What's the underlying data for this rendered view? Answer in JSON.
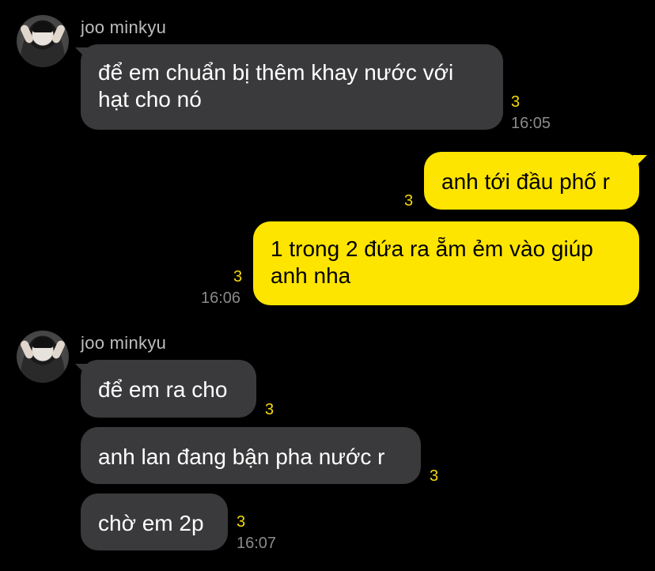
{
  "messages": [
    {
      "sender": "joo minkyu",
      "text_lines": [
        "để em chuẩn bị thêm khay nước với",
        "hạt cho nó"
      ],
      "unread": "3",
      "time": "16:05"
    },
    {
      "text": "anh tới đầu phố r",
      "unread": "3"
    },
    {
      "text_lines": [
        "1 trong 2 đứa ra ẵm ẻm vào giúp",
        "anh nha"
      ],
      "unread": "3",
      "time": "16:06"
    },
    {
      "sender": "joo minkyu",
      "text": "để em ra cho",
      "unread": "3"
    },
    {
      "text": "anh lan đang bận pha nước r",
      "unread": "3"
    },
    {
      "text": "chờ em 2p",
      "unread": "3",
      "time": "16:07"
    }
  ]
}
